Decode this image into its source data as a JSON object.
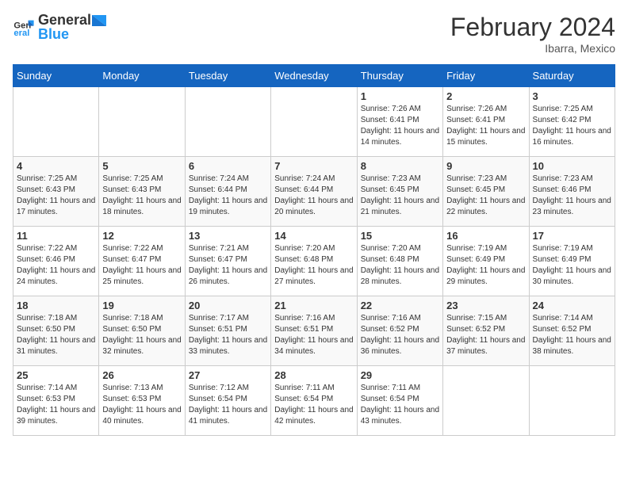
{
  "header": {
    "logo_general": "General",
    "logo_blue": "Blue",
    "title": "February 2024",
    "subtitle": "Ibarra, Mexico"
  },
  "days_of_week": [
    "Sunday",
    "Monday",
    "Tuesday",
    "Wednesday",
    "Thursday",
    "Friday",
    "Saturday"
  ],
  "weeks": [
    [
      {
        "day": "",
        "info": ""
      },
      {
        "day": "",
        "info": ""
      },
      {
        "day": "",
        "info": ""
      },
      {
        "day": "",
        "info": ""
      },
      {
        "day": "1",
        "info": "Sunrise: 7:26 AM\nSunset: 6:41 PM\nDaylight: 11 hours and 14 minutes."
      },
      {
        "day": "2",
        "info": "Sunrise: 7:26 AM\nSunset: 6:41 PM\nDaylight: 11 hours and 15 minutes."
      },
      {
        "day": "3",
        "info": "Sunrise: 7:25 AM\nSunset: 6:42 PM\nDaylight: 11 hours and 16 minutes."
      }
    ],
    [
      {
        "day": "4",
        "info": "Sunrise: 7:25 AM\nSunset: 6:43 PM\nDaylight: 11 hours and 17 minutes."
      },
      {
        "day": "5",
        "info": "Sunrise: 7:25 AM\nSunset: 6:43 PM\nDaylight: 11 hours and 18 minutes."
      },
      {
        "day": "6",
        "info": "Sunrise: 7:24 AM\nSunset: 6:44 PM\nDaylight: 11 hours and 19 minutes."
      },
      {
        "day": "7",
        "info": "Sunrise: 7:24 AM\nSunset: 6:44 PM\nDaylight: 11 hours and 20 minutes."
      },
      {
        "day": "8",
        "info": "Sunrise: 7:23 AM\nSunset: 6:45 PM\nDaylight: 11 hours and 21 minutes."
      },
      {
        "day": "9",
        "info": "Sunrise: 7:23 AM\nSunset: 6:45 PM\nDaylight: 11 hours and 22 minutes."
      },
      {
        "day": "10",
        "info": "Sunrise: 7:23 AM\nSunset: 6:46 PM\nDaylight: 11 hours and 23 minutes."
      }
    ],
    [
      {
        "day": "11",
        "info": "Sunrise: 7:22 AM\nSunset: 6:46 PM\nDaylight: 11 hours and 24 minutes."
      },
      {
        "day": "12",
        "info": "Sunrise: 7:22 AM\nSunset: 6:47 PM\nDaylight: 11 hours and 25 minutes."
      },
      {
        "day": "13",
        "info": "Sunrise: 7:21 AM\nSunset: 6:47 PM\nDaylight: 11 hours and 26 minutes."
      },
      {
        "day": "14",
        "info": "Sunrise: 7:20 AM\nSunset: 6:48 PM\nDaylight: 11 hours and 27 minutes."
      },
      {
        "day": "15",
        "info": "Sunrise: 7:20 AM\nSunset: 6:48 PM\nDaylight: 11 hours and 28 minutes."
      },
      {
        "day": "16",
        "info": "Sunrise: 7:19 AM\nSunset: 6:49 PM\nDaylight: 11 hours and 29 minutes."
      },
      {
        "day": "17",
        "info": "Sunrise: 7:19 AM\nSunset: 6:49 PM\nDaylight: 11 hours and 30 minutes."
      }
    ],
    [
      {
        "day": "18",
        "info": "Sunrise: 7:18 AM\nSunset: 6:50 PM\nDaylight: 11 hours and 31 minutes."
      },
      {
        "day": "19",
        "info": "Sunrise: 7:18 AM\nSunset: 6:50 PM\nDaylight: 11 hours and 32 minutes."
      },
      {
        "day": "20",
        "info": "Sunrise: 7:17 AM\nSunset: 6:51 PM\nDaylight: 11 hours and 33 minutes."
      },
      {
        "day": "21",
        "info": "Sunrise: 7:16 AM\nSunset: 6:51 PM\nDaylight: 11 hours and 34 minutes."
      },
      {
        "day": "22",
        "info": "Sunrise: 7:16 AM\nSunset: 6:52 PM\nDaylight: 11 hours and 36 minutes."
      },
      {
        "day": "23",
        "info": "Sunrise: 7:15 AM\nSunset: 6:52 PM\nDaylight: 11 hours and 37 minutes."
      },
      {
        "day": "24",
        "info": "Sunrise: 7:14 AM\nSunset: 6:52 PM\nDaylight: 11 hours and 38 minutes."
      }
    ],
    [
      {
        "day": "25",
        "info": "Sunrise: 7:14 AM\nSunset: 6:53 PM\nDaylight: 11 hours and 39 minutes."
      },
      {
        "day": "26",
        "info": "Sunrise: 7:13 AM\nSunset: 6:53 PM\nDaylight: 11 hours and 40 minutes."
      },
      {
        "day": "27",
        "info": "Sunrise: 7:12 AM\nSunset: 6:54 PM\nDaylight: 11 hours and 41 minutes."
      },
      {
        "day": "28",
        "info": "Sunrise: 7:11 AM\nSunset: 6:54 PM\nDaylight: 11 hours and 42 minutes."
      },
      {
        "day": "29",
        "info": "Sunrise: 7:11 AM\nSunset: 6:54 PM\nDaylight: 11 hours and 43 minutes."
      },
      {
        "day": "",
        "info": ""
      },
      {
        "day": "",
        "info": ""
      }
    ]
  ]
}
